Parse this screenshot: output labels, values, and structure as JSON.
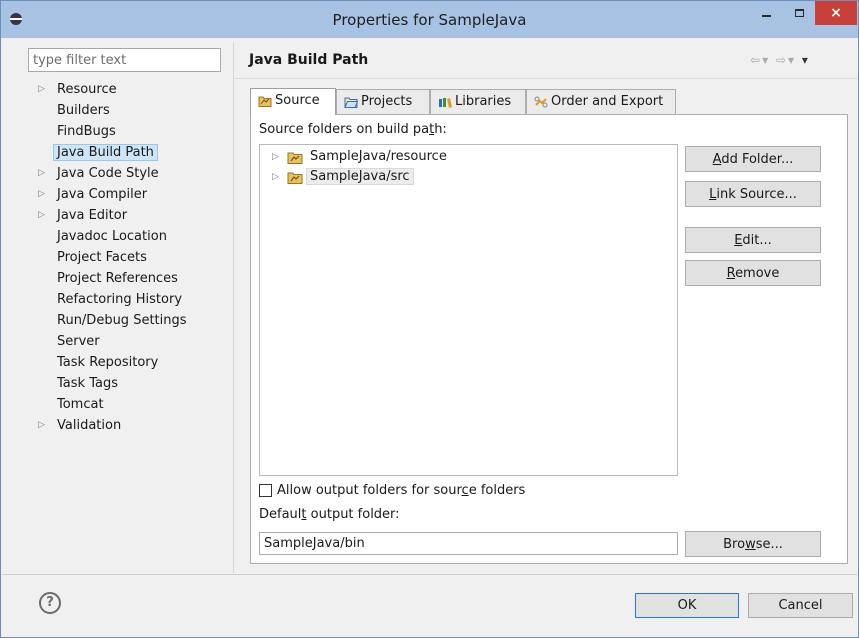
{
  "window": {
    "title": "Properties for SampleJava",
    "close_glyph": "×"
  },
  "left": {
    "filter_placeholder": "type filter text",
    "items": [
      {
        "label": "Resource",
        "expandable": true
      },
      {
        "label": "Builders",
        "expandable": false
      },
      {
        "label": "FindBugs",
        "expandable": false
      },
      {
        "label": "Java Build Path",
        "expandable": false,
        "selected": true
      },
      {
        "label": "Java Code Style",
        "expandable": true
      },
      {
        "label": "Java Compiler",
        "expandable": true
      },
      {
        "label": "Java Editor",
        "expandable": true
      },
      {
        "label": "Javadoc Location",
        "expandable": false
      },
      {
        "label": "Project Facets",
        "expandable": false
      },
      {
        "label": "Project References",
        "expandable": false
      },
      {
        "label": "Refactoring History",
        "expandable": false
      },
      {
        "label": "Run/Debug Settings",
        "expandable": false
      },
      {
        "label": "Server",
        "expandable": false
      },
      {
        "label": "Task Repository",
        "expandable": false
      },
      {
        "label": "Task Tags",
        "expandable": false
      },
      {
        "label": "Tomcat",
        "expandable": false
      },
      {
        "label": "Validation",
        "expandable": true
      }
    ],
    "expander_glyph": "▷"
  },
  "page": {
    "title": "Java Build Path",
    "nav": {
      "back": "⇦",
      "forward": "⇨",
      "dropdown": "▾",
      "menu": "▾"
    }
  },
  "tabs": [
    {
      "label": "Source",
      "active": true
    },
    {
      "label": "Projects",
      "active": false
    },
    {
      "label": "Libraries",
      "active": false
    },
    {
      "label": "Order and Export",
      "active": false
    }
  ],
  "source": {
    "label_pre": "Source folders on build pa",
    "label_mnemonic": "t",
    "label_post": "h:",
    "folders": [
      {
        "label": "SampleJava/resource"
      },
      {
        "label": "SampleJava/src",
        "highlighted": true
      }
    ],
    "buttons": {
      "add_mn": "A",
      "add_rest": "dd Folder...",
      "link_mn": "L",
      "link_rest": "ink Source...",
      "edit_mn": "E",
      "edit_rest": "dit...",
      "remove_mn": "R",
      "remove_rest": "emove"
    },
    "allow_output_pre": "Allow output folders for sour",
    "allow_output_mnemonic": "c",
    "allow_output_post": "e folders",
    "allow_output_checked": false,
    "output_label_pre": "Defaul",
    "output_label_mnemonic": "t",
    "output_label_post": " output folder:",
    "output_value": "SampleJava/bin",
    "browse_pre": "Bro",
    "browse_mnemonic": "w",
    "browse_post": "se..."
  },
  "footer": {
    "help": "?",
    "ok": "OK",
    "cancel": "Cancel"
  },
  "colors": {
    "titlebar": "#a8c2e4",
    "close": "#c7413a",
    "selection": "#cde6f7",
    "folder": "#e8c25c"
  }
}
